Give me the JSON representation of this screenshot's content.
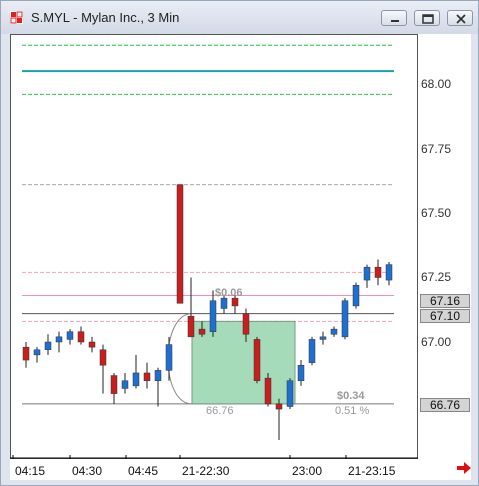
{
  "window": {
    "title": "S.MYL - Mylan Inc., 3 Min",
    "icons": [
      "app-logo-icon",
      "minimize-icon",
      "restore-icon",
      "close-icon"
    ]
  },
  "chart_data": {
    "type": "candlestick",
    "symbol": "S.MYL",
    "interval": "3 Min",
    "y_ticks": [
      "68.00",
      "67.75",
      "67.50",
      "67.25",
      "67.00"
    ],
    "ylim": [
      66.55,
      68.25
    ],
    "x_ticks": [
      "04:15",
      "04:30",
      "04:45",
      "21-22:30",
      "23:00",
      "21-23:15"
    ],
    "price_badges": [
      "67.16",
      "67.10",
      "66.76"
    ],
    "candles": [
      {
        "o": 66.98,
        "h": 67.0,
        "l": 66.9,
        "c": 66.93
      },
      {
        "o": 66.95,
        "h": 66.98,
        "l": 66.92,
        "c": 66.97
      },
      {
        "o": 66.97,
        "h": 67.03,
        "l": 66.95,
        "c": 67.0
      },
      {
        "o": 67.0,
        "h": 67.04,
        "l": 66.96,
        "c": 67.02
      },
      {
        "o": 67.01,
        "h": 67.05,
        "l": 66.99,
        "c": 67.04
      },
      {
        "o": 67.04,
        "h": 67.06,
        "l": 66.99,
        "c": 67.0
      },
      {
        "o": 67.0,
        "h": 67.02,
        "l": 66.96,
        "c": 66.98
      },
      {
        "o": 66.97,
        "h": 66.99,
        "l": 66.8,
        "c": 66.91
      },
      {
        "o": 66.87,
        "h": 66.88,
        "l": 66.76,
        "c": 66.8
      },
      {
        "o": 66.82,
        "h": 66.88,
        "l": 66.8,
        "c": 66.85
      },
      {
        "o": 66.83,
        "h": 66.95,
        "l": 66.82,
        "c": 66.88
      },
      {
        "o": 66.88,
        "h": 66.92,
        "l": 66.82,
        "c": 66.85
      },
      {
        "o": 66.85,
        "h": 66.9,
        "l": 66.75,
        "c": 66.89
      },
      {
        "o": 66.89,
        "h": 67.02,
        "l": 66.85,
        "c": 66.99
      },
      {
        "o": 67.61,
        "h": 67.61,
        "l": 67.15,
        "c": 67.15
      },
      {
        "o": 67.1,
        "h": 67.25,
        "l": 67.03,
        "c": 67.02
      },
      {
        "o": 67.05,
        "h": 67.08,
        "l": 67.02,
        "c": 67.03
      },
      {
        "o": 67.04,
        "h": 67.2,
        "l": 67.02,
        "c": 67.16
      },
      {
        "o": 67.13,
        "h": 67.18,
        "l": 67.11,
        "c": 67.17
      },
      {
        "o": 67.17,
        "h": 67.18,
        "l": 67.11,
        "c": 67.14
      },
      {
        "o": 67.11,
        "h": 67.13,
        "l": 67.0,
        "c": 67.03
      },
      {
        "o": 67.01,
        "h": 67.02,
        "l": 66.84,
        "c": 66.85
      },
      {
        "o": 66.86,
        "h": 66.88,
        "l": 66.75,
        "c": 66.76
      },
      {
        "o": 66.76,
        "h": 66.78,
        "l": 66.62,
        "c": 66.74
      },
      {
        "o": 66.75,
        "h": 66.86,
        "l": 66.74,
        "c": 66.85
      },
      {
        "o": 66.85,
        "h": 66.93,
        "l": 66.83,
        "c": 66.91
      },
      {
        "o": 66.92,
        "h": 67.02,
        "l": 66.91,
        "c": 67.01
      },
      {
        "o": 67.01,
        "h": 67.04,
        "l": 66.99,
        "c": 67.02
      },
      {
        "o": 67.03,
        "h": 67.06,
        "l": 67.02,
        "c": 67.05
      },
      {
        "o": 67.02,
        "h": 67.17,
        "l": 67.01,
        "c": 67.16
      },
      {
        "o": 67.14,
        "h": 67.23,
        "l": 67.13,
        "c": 67.22
      },
      {
        "o": 67.24,
        "h": 67.3,
        "l": 67.21,
        "c": 67.29
      },
      {
        "o": 67.29,
        "h": 67.32,
        "l": 67.22,
        "c": 67.25
      },
      {
        "o": 67.24,
        "h": 67.31,
        "l": 67.22,
        "c": 67.3
      }
    ],
    "levels": [
      {
        "price": 68.15,
        "color": "#27c24a",
        "style": "dashed"
      },
      {
        "price": 68.05,
        "color": "#16a2ac",
        "style": "solid"
      },
      {
        "price": 67.96,
        "color": "#27c24a",
        "style": "dashed"
      },
      {
        "price": 67.61,
        "color": "#aaaaaa",
        "style": "dashed"
      },
      {
        "price": 67.27,
        "color": "#f2a0c4",
        "style": "dashed"
      },
      {
        "price": 67.18,
        "color": "#f08cc0",
        "style": "solid"
      },
      {
        "price": 67.11,
        "color": "#555555",
        "style": "solid"
      },
      {
        "price": 67.08,
        "color": "#f2a0c4",
        "style": "dashed"
      },
      {
        "price": 66.76,
        "color": "#777777",
        "style": "solid"
      }
    ],
    "annotations": {
      "top_change": "$0.06",
      "bottom_change": "$0.34",
      "bottom_price": "66.76",
      "bottom_pct": "0.51 %"
    },
    "colors": {
      "up": "#1e6fd0",
      "down": "#c81e1e",
      "box": "#5cbe82"
    }
  }
}
